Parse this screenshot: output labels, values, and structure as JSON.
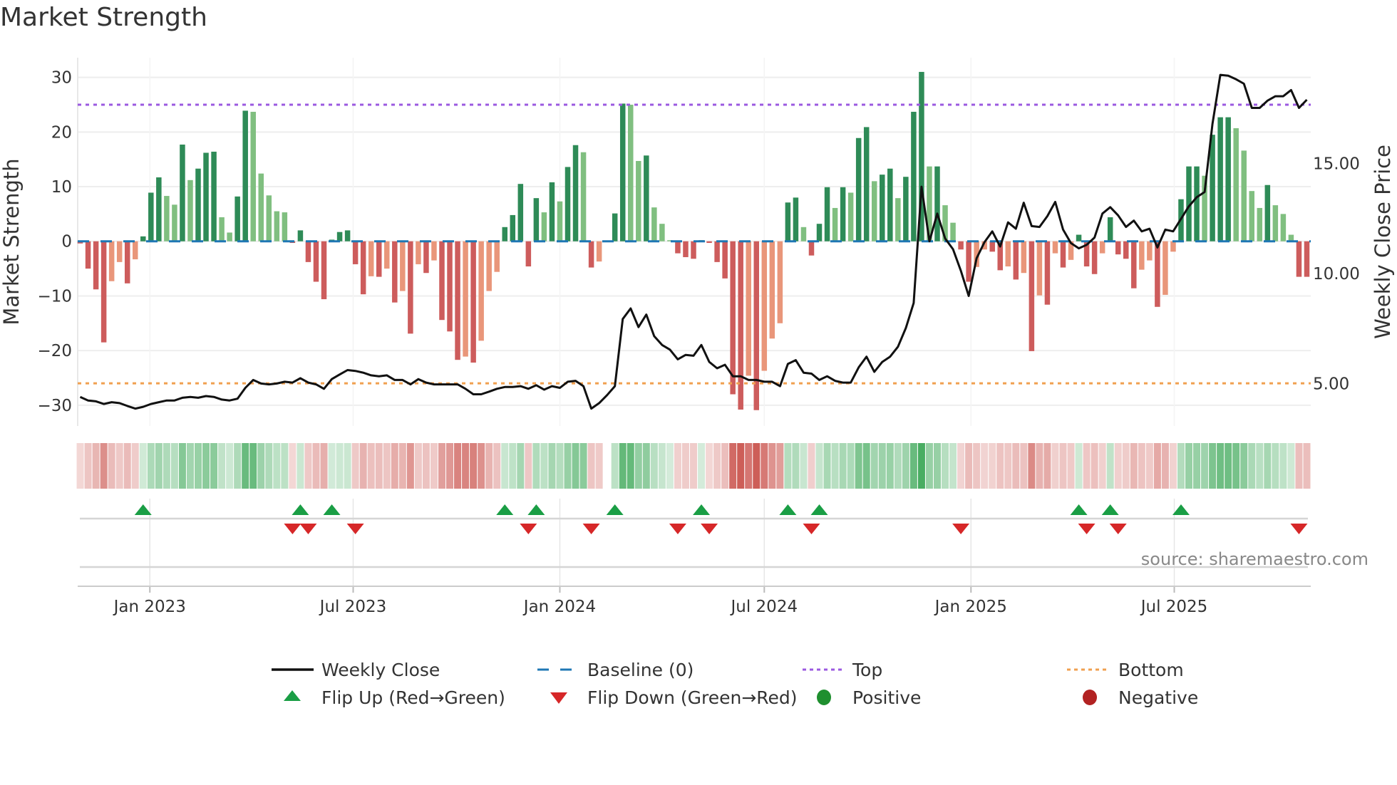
{
  "title": "Market Strength",
  "source": "source: sharemaestro.com",
  "chart_data": {
    "type": "bar",
    "title": "Market Strength",
    "start_week": "2022-10-31",
    "frequency": "weekly",
    "ylabel": "Market Strength",
    "y2label": "Weekly Close Price",
    "ylim": [
      -33.8,
      33.6
    ],
    "y2lim": [
      3.07,
      19.8
    ],
    "yticks": [
      "30",
      "20",
      "10",
      "0",
      "−10",
      "−20",
      "−30"
    ],
    "ytick_values": [
      30,
      20,
      10,
      0,
      -10,
      -20,
      -30
    ],
    "y2ticks": [
      "15.00",
      "10.00",
      "5.00"
    ],
    "y2tick_values": [
      15,
      10,
      5
    ],
    "xticks": [
      {
        "label": "Jan 2023",
        "date": "2023-01-01"
      },
      {
        "label": "Jul 2023",
        "date": "2023-07-01"
      },
      {
        "label": "Jan 2024",
        "date": "2024-01-01"
      },
      {
        "label": "Jul 2024",
        "date": "2024-07-01"
      },
      {
        "label": "Jan 2025",
        "date": "2025-01-01"
      },
      {
        "label": "Jul 2025",
        "date": "2025-07-01"
      }
    ],
    "top_level": 25,
    "bottom_level": -26,
    "strength": [
      -0.4,
      -5.0,
      -8.8,
      -18.5,
      -7.3,
      -3.8,
      -7.7,
      -3.3,
      0.9,
      8.9,
      11.7,
      8.3,
      6.7,
      17.7,
      11.2,
      13.3,
      16.2,
      16.4,
      4.4,
      1.6,
      8.2,
      23.9,
      23.7,
      12.4,
      8.4,
      5.5,
      5.3,
      -0.3,
      2.0,
      -3.8,
      -7.4,
      -10.6,
      0.3,
      1.7,
      2.0,
      -4.2,
      -9.7,
      -6.4,
      -6.5,
      -5.0,
      -11.2,
      -9.1,
      -16.9,
      -4.2,
      -5.8,
      -3.5,
      -14.4,
      -16.5,
      -21.7,
      -21.1,
      -22.2,
      -18.2,
      -9.1,
      -5.6,
      2.6,
      4.8,
      10.5,
      -4.6,
      7.9,
      5.3,
      10.8,
      7.3,
      13.6,
      17.6,
      16.3,
      -4.8,
      -3.7,
      0,
      5.1,
      25.2,
      25.0,
      14.7,
      15.7,
      6.2,
      3.2,
      0.2,
      -2.2,
      -2.9,
      -3.2,
      0.2,
      -0.3,
      -3.8,
      -6.8,
      -28.0,
      -30.8,
      -24.6,
      -30.9,
      -23.7,
      -17.8,
      -15.0,
      7.1,
      8.0,
      2.6,
      -2.6,
      3.2,
      9.9,
      6.1,
      9.9,
      8.9,
      18.9,
      20.9,
      11.0,
      12.2,
      13.3,
      7.9,
      11.8,
      23.7,
      31.0,
      13.7,
      13.7,
      6.6,
      3.4,
      -1.5,
      -7.4,
      -4.7,
      -1.5,
      -1.9,
      -5.3,
      -4.6,
      -7.0,
      -5.8,
      -20.1,
      -9.9,
      -11.6,
      -2.2,
      -4.8,
      -3.4,
      1.2,
      -4.6,
      -6.0,
      -2.2,
      4.4,
      -2.4,
      -3.2,
      -8.6,
      -5.2,
      -3.5,
      -12.0,
      -9.8,
      -1.9,
      7.7,
      13.7,
      13.7,
      12.0,
      19.5,
      22.7,
      22.7,
      20.7,
      16.6,
      9.2,
      6.1,
      10.3,
      6.6,
      5.0,
      1.2,
      -6.5,
      -6.5
    ],
    "weekly_close": [
      4.39,
      4.23,
      4.19,
      4.07,
      4.15,
      4.11,
      3.98,
      3.86,
      3.94,
      4.07,
      4.15,
      4.23,
      4.23,
      4.35,
      4.39,
      4.35,
      4.43,
      4.39,
      4.27,
      4.23,
      4.31,
      4.8,
      5.16,
      5.0,
      4.96,
      5.0,
      5.08,
      5.04,
      5.24,
      5.04,
      4.96,
      4.76,
      5.2,
      5.41,
      5.61,
      5.57,
      5.49,
      5.37,
      5.33,
      5.37,
      5.16,
      5.16,
      4.96,
      5.2,
      5.04,
      4.96,
      4.96,
      4.96,
      4.96,
      4.76,
      4.51,
      4.51,
      4.63,
      4.76,
      4.84,
      4.84,
      4.88,
      4.76,
      4.92,
      4.72,
      4.88,
      4.8,
      5.08,
      5.12,
      4.88,
      3.86,
      4.11,
      4.47,
      4.88,
      7.93,
      8.41,
      7.56,
      8.13,
      7.15,
      6.75,
      6.54,
      6.1,
      6.3,
      6.26,
      6.75,
      5.98,
      5.69,
      5.85,
      5.33,
      5.33,
      5.16,
      5.16,
      5.08,
      5.08,
      4.88,
      5.89,
      6.06,
      5.49,
      5.45,
      5.16,
      5.33,
      5.12,
      5.04,
      5.04,
      5.73,
      6.22,
      5.53,
      5.98,
      6.22,
      6.67,
      7.52,
      8.66,
      13.94,
      11.46,
      12.72,
      11.59,
      11.1,
      10.12,
      8.98,
      10.69,
      11.42,
      11.91,
      11.22,
      12.32,
      12.03,
      13.21,
      12.15,
      12.11,
      12.6,
      13.25,
      11.99,
      11.38,
      11.14,
      11.3,
      11.63,
      12.72,
      13.01,
      12.64,
      12.11,
      12.4,
      11.91,
      12.03,
      11.18,
      11.99,
      11.91,
      12.48,
      13.05,
      13.46,
      13.7,
      16.79,
      19.02,
      18.98,
      18.82,
      18.62,
      17.52,
      17.52,
      17.85,
      18.05,
      18.05,
      18.33,
      17.52,
      17.89
    ],
    "flip_up_week_index": [
      8,
      28,
      32,
      54,
      58,
      68,
      79,
      90,
      94,
      127,
      131,
      140
    ],
    "flip_down_week_index": [
      27,
      29,
      35,
      57,
      65,
      76,
      80,
      93,
      112,
      128,
      132,
      155
    ],
    "legend": {
      "placement": "bottom",
      "weekly_close": "Weekly Close",
      "baseline": "Baseline (0)",
      "top": "Top",
      "bottom": "Bottom",
      "flip_up": "Flip Up (Red→Green)",
      "flip_down": "Flip Down (Green→Red)",
      "positive": "Positive",
      "negative": "Negative"
    },
    "colors": {
      "pos_strong": "#2e8b57",
      "pos_weak": "#80bf80",
      "neg_strong": "#cd5c5c",
      "neg_weak": "#e9967a",
      "baseline": "#1f77b4",
      "top": "#9b59e0",
      "bottom": "#f0a050",
      "line": "#111111",
      "flip_up": "#1a9e45",
      "flip_down": "#d62728",
      "positive_dot": "#1f8f2f",
      "negative_dot": "#b22222"
    }
  }
}
